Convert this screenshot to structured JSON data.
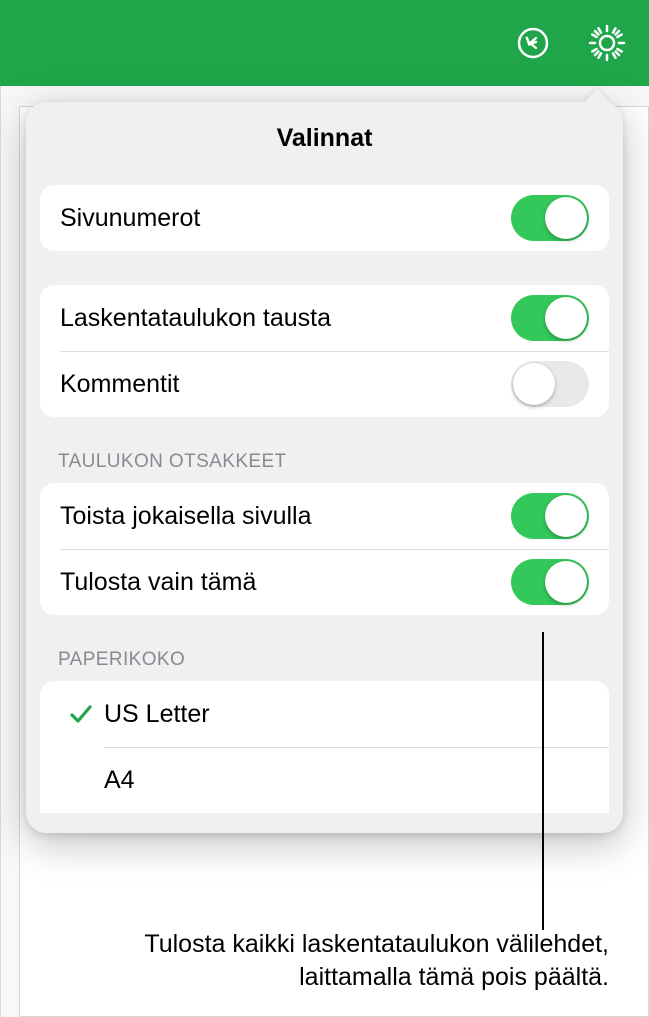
{
  "popover": {
    "title": "Valinnat",
    "group1": {
      "page_numbers": {
        "label": "Sivunumerot",
        "on": true
      }
    },
    "group2": {
      "background": {
        "label": "Laskentataulukon tausta",
        "on": true
      },
      "comments": {
        "label": "Kommentit",
        "on": false
      }
    },
    "table_headers": {
      "header": "TAULUKON OTSAKKEET",
      "repeat": {
        "label": "Toista jokaisella sivulla",
        "on": true
      },
      "print_only": {
        "label": "Tulosta vain tämä",
        "on": true
      }
    },
    "paper_size": {
      "header": "PAPERIKOKO",
      "options": [
        {
          "label": "US Letter",
          "selected": true
        },
        {
          "label": "A4",
          "selected": false
        }
      ]
    }
  },
  "annotation": {
    "text": "Tulosta kaikki laskentataulukon välilehdet, laittamalla tämä pois päältä."
  },
  "colors": {
    "header_green": "#1fa54a",
    "toggle_on": "#34c759"
  }
}
